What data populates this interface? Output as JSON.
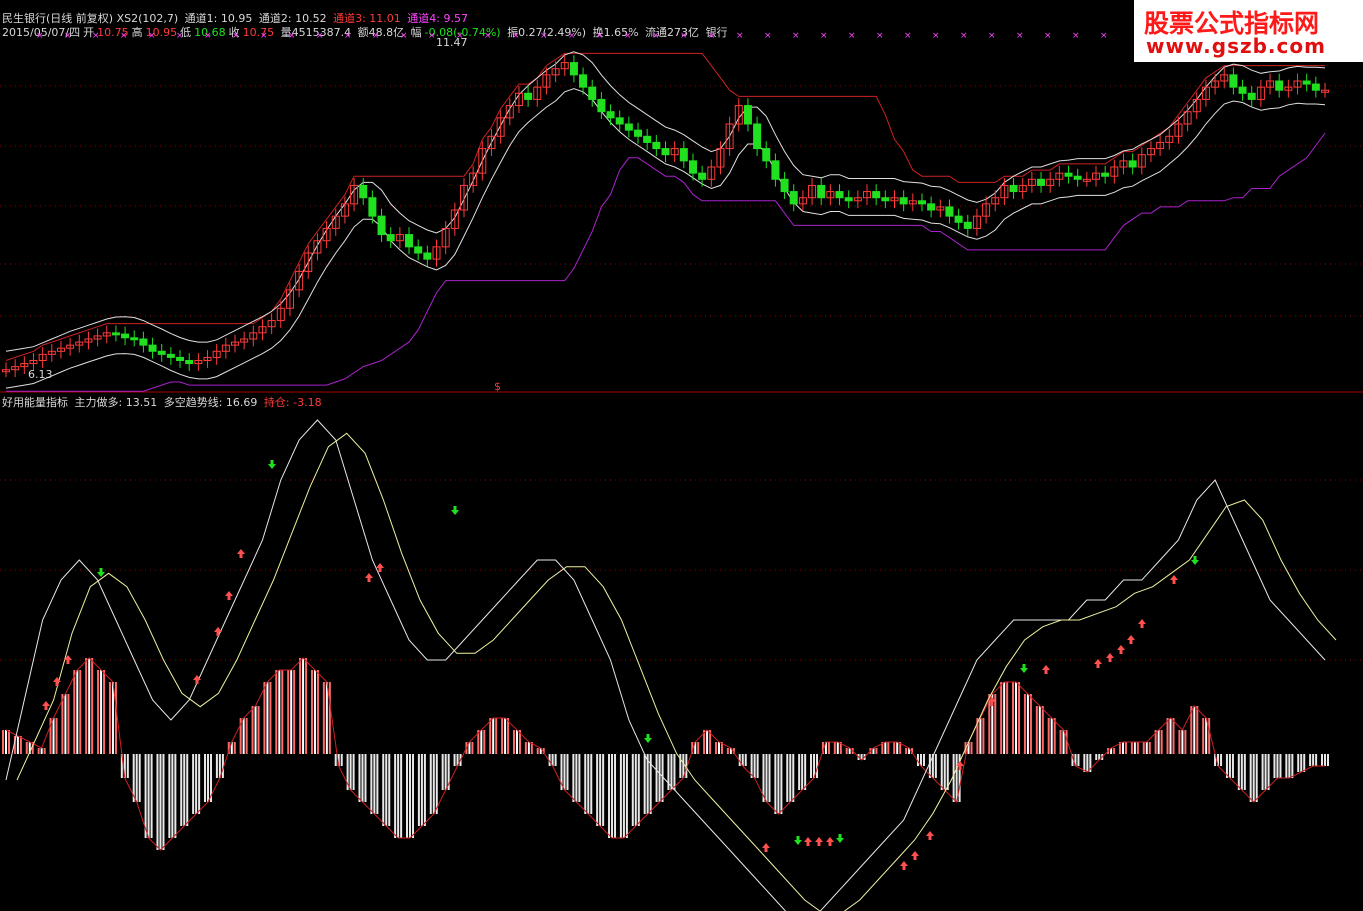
{
  "colors": {
    "bg": "#000000",
    "up": "#ff3b3b",
    "down": "#20e020",
    "channel_upper": "#cc2222",
    "channel_lower": "#aa22cc",
    "grid": "#8b0000",
    "white": "#e0e0e0"
  },
  "header": {
    "title": "民生银行(日线 前复权) XS2(102,7)",
    "ch1": "通道1: 10.95",
    "ch2": "通道2: 10.52",
    "ch3": "通道3: 11.01",
    "ch4": "通道4: 9.57",
    "date": "2015/05/07/四",
    "open_label": "开",
    "open": "10.75",
    "high_label": "高",
    "high": "10.95",
    "low_label": "低",
    "low": "10.68",
    "close_label": "收",
    "close": "10.75",
    "volume": "量4515387.4",
    "amount": "额48.8亿",
    "amp_label": "幅",
    "amp": "-0.08(-0.74%)",
    "swing": "振0.27(2.49%)",
    "turnover": "换1.65%",
    "float": "流通273亿",
    "sector": "银行"
  },
  "indicator": {
    "name": "好用能量指标",
    "main_force": "主力做多: 13.51",
    "trend": "多空趋势线: 16.69",
    "position": "持仓: -3.18"
  },
  "logo": {
    "cn": "股票公式指标网",
    "url": "www.gszb.com"
  },
  "chart_data": [
    {
      "type": "candlestick",
      "title": "民生银行(日线 前复权)",
      "max_label": "11.47",
      "min_label": "6.13",
      "marker": "$",
      "close": [
        6.2,
        6.25,
        6.3,
        6.35,
        6.45,
        6.5,
        6.55,
        6.6,
        6.65,
        6.7,
        6.75,
        6.8,
        6.78,
        6.72,
        6.7,
        6.6,
        6.5,
        6.45,
        6.4,
        6.35,
        6.3,
        6.35,
        6.4,
        6.5,
        6.6,
        6.65,
        6.7,
        6.8,
        6.9,
        7.0,
        7.2,
        7.5,
        7.8,
        8.1,
        8.3,
        8.5,
        8.7,
        8.9,
        9.2,
        9.0,
        8.7,
        8.4,
        8.3,
        8.4,
        8.2,
        8.1,
        8.0,
        8.2,
        8.5,
        8.8,
        9.2,
        9.4,
        9.8,
        10.0,
        10.3,
        10.5,
        10.7,
        10.6,
        10.8,
        11.0,
        11.1,
        11.2,
        11.0,
        10.8,
        10.6,
        10.4,
        10.3,
        10.2,
        10.1,
        10.0,
        9.9,
        9.8,
        9.7,
        9.8,
        9.6,
        9.4,
        9.3,
        9.5,
        9.8,
        10.2,
        10.5,
        10.2,
        9.8,
        9.6,
        9.3,
        9.1,
        8.9,
        9.0,
        9.2,
        9.0,
        9.1,
        9.0,
        8.95,
        9.0,
        9.1,
        9.0,
        8.95,
        9.0,
        8.9,
        8.95,
        8.9,
        8.8,
        8.85,
        8.7,
        8.6,
        8.5,
        8.7,
        8.9,
        9.0,
        9.2,
        9.1,
        9.2,
        9.3,
        9.2,
        9.3,
        9.4,
        9.35,
        9.3,
        9.3,
        9.4,
        9.35,
        9.5,
        9.6,
        9.5,
        9.7,
        9.8,
        9.9,
        10.0,
        10.2,
        10.4,
        10.6,
        10.8,
        10.9,
        11.0,
        10.8,
        10.7,
        10.6,
        10.8,
        10.9,
        10.75,
        10.8,
        10.9,
        10.85,
        10.75,
        10.75
      ]
    },
    {
      "type": "histogram",
      "title": "好用能量指标",
      "series": [
        {
          "name": "主力做多",
          "values": [
            2,
            1.5,
            1,
            0.5,
            3,
            5,
            7,
            8,
            7,
            6,
            -2,
            -4,
            -7,
            -8,
            -7,
            -6,
            -5,
            -4,
            -2,
            1,
            3,
            4,
            6,
            7,
            7,
            8,
            7,
            6,
            -1,
            -3,
            -4,
            -5,
            -6,
            -7,
            -7,
            -6,
            -5,
            -3,
            -1,
            1,
            2,
            3,
            3,
            2,
            1,
            0.5,
            -1,
            -3,
            -4,
            -5,
            -6,
            -7,
            -7,
            -6,
            -5,
            -4,
            -3,
            -2,
            1,
            2,
            1,
            0.5,
            -1,
            -2,
            -4,
            -5,
            -4,
            -3,
            -2,
            1,
            1,
            0.5,
            -0.5,
            0.5,
            1,
            1,
            0.5,
            -1,
            -2,
            -3,
            -4,
            1,
            3,
            5,
            6,
            6,
            5,
            4,
            3,
            2,
            -1,
            -1.5,
            -0.5,
            0.5,
            1,
            1,
            1,
            2,
            3,
            2,
            4,
            3,
            -1,
            -2,
            -3,
            -4,
            -3,
            -2,
            -2,
            -1.5,
            -1,
            -1
          ]
        },
        {
          "name": "多空趋势线",
          "values": [
            -1,
            3,
            7,
            9,
            10,
            9,
            7,
            5,
            3,
            2,
            3,
            5,
            7,
            9,
            11,
            14,
            16,
            17,
            16,
            13,
            10,
            8,
            6,
            5,
            5,
            6,
            7,
            8,
            9,
            10,
            10,
            9,
            7,
            5,
            2,
            0,
            -1,
            -2,
            -3,
            -4,
            -5,
            -6,
            -7,
            -8,
            -8,
            -7,
            -6,
            -5,
            -4,
            -3,
            -1,
            1,
            3,
            5,
            6,
            7,
            7,
            7,
            7,
            8,
            8,
            9,
            9,
            10,
            11,
            13,
            14,
            12,
            10,
            8,
            7,
            6,
            5
          ]
        },
        {
          "name": "持仓",
          "values": [
            -3.18
          ]
        }
      ]
    }
  ]
}
